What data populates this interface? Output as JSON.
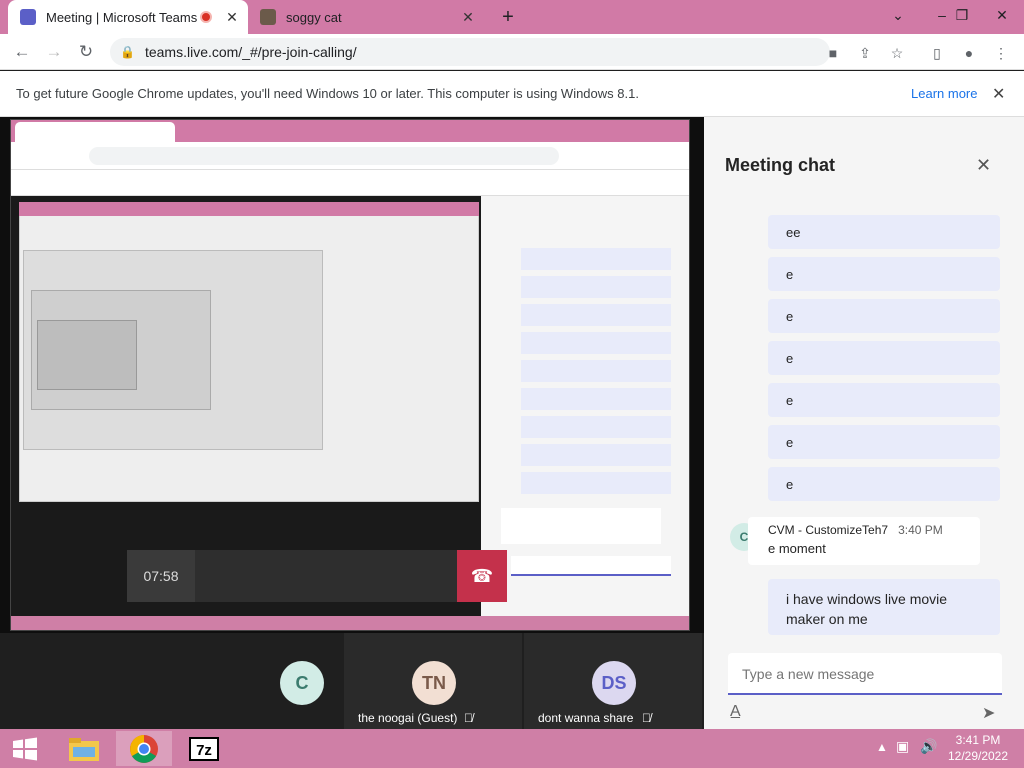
{
  "browser": {
    "tabs": [
      {
        "title": "Meeting | Microsoft Teams",
        "recording": true
      },
      {
        "title": "soggy cat"
      }
    ],
    "url": "teams.live.com/_#/pre-join-calling/",
    "infobar": {
      "message": "To get future Google Chrome updates, you'll need Windows 10 or later. This computer is using Windows 8.1.",
      "learn_more": "Learn more"
    }
  },
  "call": {
    "timer": "07:58",
    "participants": [
      {
        "initials": "C",
        "name": ""
      },
      {
        "initials": "TN",
        "name": "the noogai (Guest)"
      },
      {
        "initials": "DS",
        "name": "dont wanna share"
      }
    ]
  },
  "chat": {
    "title": "Meeting chat",
    "messages": [
      "ee",
      "e",
      "e",
      "e",
      "e",
      "e",
      "e"
    ],
    "latest": {
      "avatar": "C",
      "author": "CVM - CustomizeTeh7",
      "time": "3:40 PM",
      "text": "e moment"
    },
    "own_message": "i have windows live movie maker on me",
    "input_placeholder": "Type a new message"
  },
  "taskbar": {
    "time": "3:41 PM",
    "date": "12/29/2022"
  }
}
